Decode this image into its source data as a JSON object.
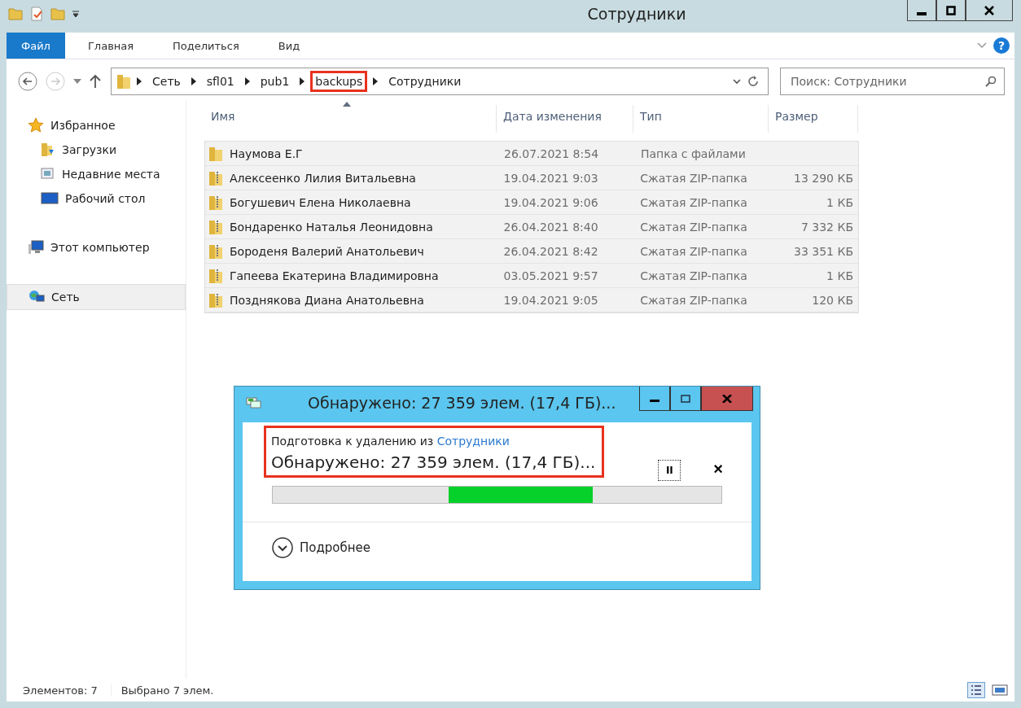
{
  "window": {
    "title": "Сотрудники"
  },
  "ribbon_tabs": [
    {
      "label": "Файл",
      "selected": true
    },
    {
      "label": "Главная",
      "selected": false
    },
    {
      "label": "Поделиться",
      "selected": false
    },
    {
      "label": "Вид",
      "selected": false
    }
  ],
  "address": {
    "crumbs": [
      {
        "label": "Сеть",
        "highlighted": false
      },
      {
        "label": "sfl01",
        "highlighted": false
      },
      {
        "label": "pub1",
        "highlighted": false
      },
      {
        "label": "backups",
        "highlighted": true
      },
      {
        "label": "Сотрудники",
        "highlighted": false
      }
    ]
  },
  "help": "?",
  "search": {
    "placeholder": "Поиск: Сотрудники"
  },
  "sidebar": {
    "items": [
      {
        "label": "Избранное",
        "kind": "star",
        "selected": false,
        "children": [
          {
            "label": "Загрузки",
            "kind": "downloads",
            "selected": false
          },
          {
            "label": "Недавние места",
            "kind": "recent",
            "selected": false
          },
          {
            "label": "Рабочий стол",
            "kind": "desktop",
            "selected": false
          }
        ]
      },
      {
        "label": "Этот компьютер",
        "kind": "computer",
        "selected": false
      },
      {
        "label": "Сеть",
        "kind": "network",
        "selected": true
      }
    ]
  },
  "table": {
    "columns": [
      "Имя",
      "Дата изменения",
      "Тип",
      "Размер"
    ],
    "rows": [
      {
        "kind": "folder",
        "selected": true,
        "cells": [
          "Наумова Е.Г",
          "26.07.2021 8:54",
          "Папка с файлами",
          ""
        ]
      },
      {
        "kind": "zip",
        "selected": true,
        "cells": [
          "Алексеенко Лилия Витальевна",
          "19.04.2021 9:03",
          "Сжатая ZIP-папка",
          "13 290 КБ"
        ]
      },
      {
        "kind": "zip",
        "selected": true,
        "cells": [
          "Богушевич Елена Николаевна",
          "19.04.2021 9:06",
          "Сжатая ZIP-папка",
          "1 КБ"
        ]
      },
      {
        "kind": "zip",
        "selected": true,
        "cells": [
          "Бондаренко Наталья Леонидовна",
          "26.04.2021 8:40",
          "Сжатая ZIP-папка",
          "7 332 КБ"
        ]
      },
      {
        "kind": "zip",
        "selected": true,
        "cells": [
          "Бороденя Валерий Анатольевич",
          "26.04.2021 8:42",
          "Сжатая ZIP-папка",
          "33 351 КБ"
        ]
      },
      {
        "kind": "zip",
        "selected": true,
        "cells": [
          "Гапеева Екатерина Владимировна",
          "03.05.2021 9:57",
          "Сжатая ZIP-папка",
          "1 КБ"
        ]
      },
      {
        "kind": "zip",
        "selected": true,
        "cells": [
          "Позднякова Диана Анатольевна",
          "19.04.2021 9:05",
          "Сжатая ZIP-папка",
          "120 КБ"
        ]
      }
    ]
  },
  "dialog": {
    "title": "Обнаружено: 27 359 элем. (17,4 ГБ)...",
    "highlighted": true,
    "line1": "Подготовка к удалению из",
    "link": "Сотрудники",
    "status": "Обнаружено: 27 359 элем. (17,4 ГБ)...",
    "pause": "II",
    "close": "×",
    "more": "Подробнее"
  },
  "status_bar": {
    "items": "Элементов: 7",
    "selected": "Выбрано 7 элем."
  }
}
